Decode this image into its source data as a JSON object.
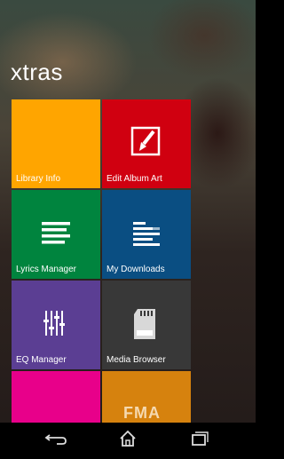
{
  "page": {
    "title": "xtras"
  },
  "tiles": [
    {
      "label": "Library Info",
      "color": "#ffa500",
      "icon": ""
    },
    {
      "label": "Edit Album Art",
      "color": "#d00010",
      "icon": "image-edit-icon"
    },
    {
      "label": "Lyrics Manager",
      "color": "#00843e",
      "icon": "lines-icon"
    },
    {
      "label": "My Downloads",
      "color": "#0a4e82",
      "icon": "download-list-icon"
    },
    {
      "label": "Media Browser",
      "color": "#383838",
      "icon": "sd-card-icon"
    },
    {
      "label": "EQ Manager",
      "color": "#5b3e93",
      "icon": "equalizer-icon"
    },
    {
      "label": "",
      "color": "#e8008a",
      "icon": ""
    },
    {
      "label": "FMA",
      "color": "#d6820e",
      "icon": "fma-logo"
    }
  ],
  "navbar": {
    "back": "back-icon",
    "home": "home-icon",
    "recents": "recents-icon"
  }
}
